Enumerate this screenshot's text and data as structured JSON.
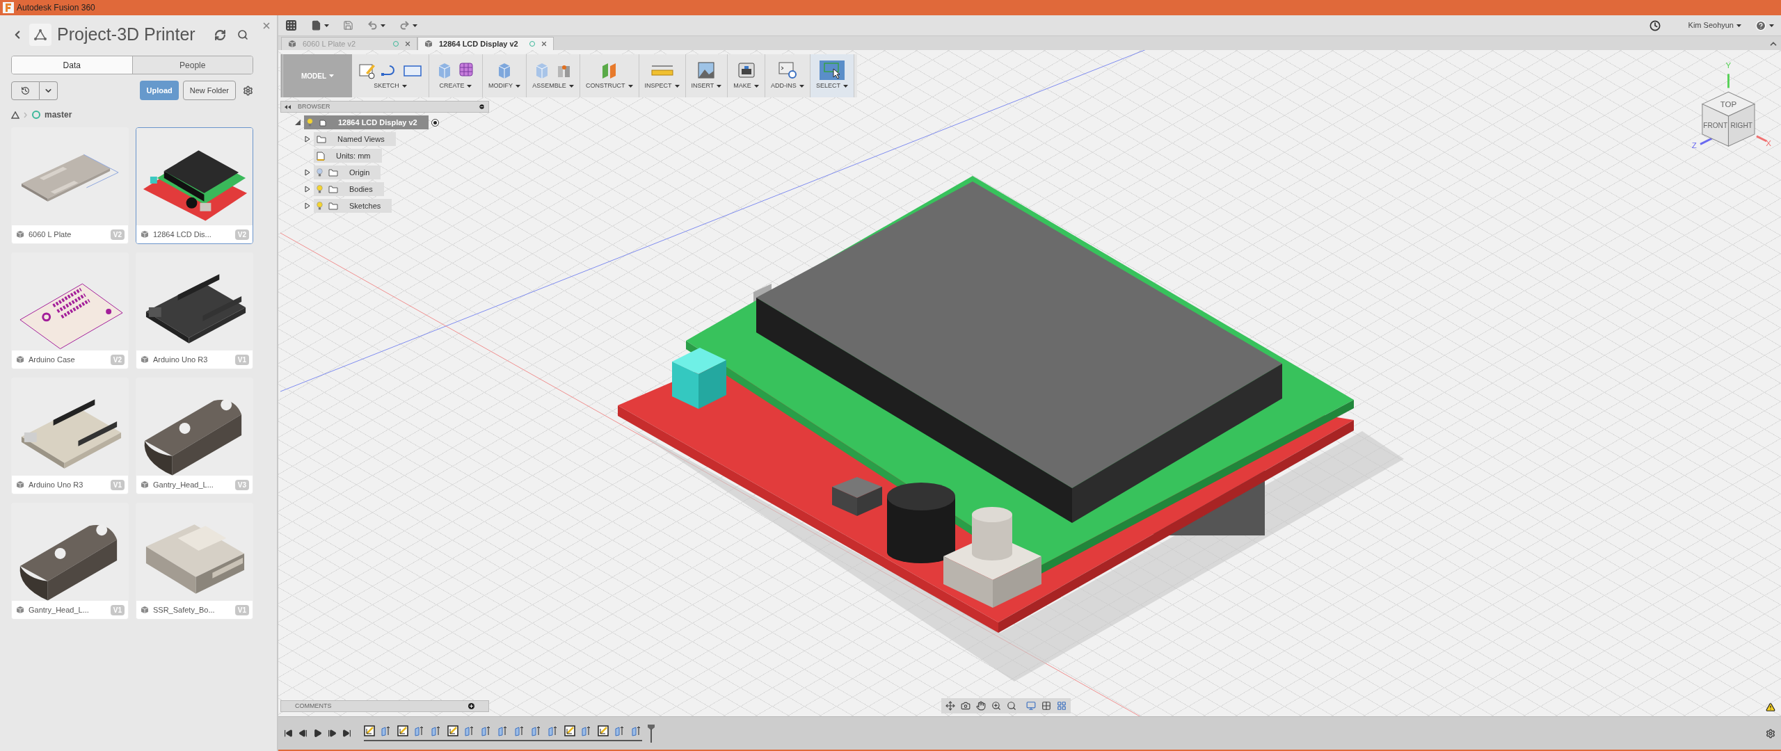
{
  "window": {
    "title": "Autodesk Fusion 360"
  },
  "data_panel": {
    "title": "Project-3D Printer",
    "tabs": [
      {
        "label": "Data",
        "selected": true
      },
      {
        "label": "People",
        "selected": false
      }
    ],
    "buttons": [
      {
        "label": "Upload",
        "kind": "primary"
      },
      {
        "label": "New Folder",
        "kind": "secondary"
      }
    ],
    "breadcrumb": "master",
    "files": [
      {
        "name": "6060 L Plate",
        "version": "V2",
        "selected": false
      },
      {
        "name": "12864 LCD Dis...",
        "version": "V2",
        "selected": true
      },
      {
        "name": "Arduino Case",
        "version": "V2",
        "selected": false
      },
      {
        "name": "Arduino Uno R3",
        "version": "V1",
        "selected": false
      },
      {
        "name": "Arduino Uno R3",
        "version": "V1",
        "selected": false
      },
      {
        "name": "Gantry_Head_L...",
        "version": "V3",
        "selected": false
      },
      {
        "name": "Gantry_Head_L...",
        "version": "V1",
        "selected": false
      },
      {
        "name": "SSR_Safety_Bo...",
        "version": "V1",
        "selected": false
      }
    ]
  },
  "app_bar": {
    "user": "Kim Seohyun"
  },
  "document_tabs": [
    {
      "label": "6060 L Plate v2",
      "selected": false
    },
    {
      "label": "12864 LCD Display v2",
      "selected": true
    }
  ],
  "toolbar": {
    "workspace": "MODEL",
    "groups": [
      {
        "label": "SKETCH",
        "selected": false
      },
      {
        "label": "CREATE",
        "selected": false
      },
      {
        "label": "MODIFY",
        "selected": false
      },
      {
        "label": "ASSEMBLE",
        "selected": false
      },
      {
        "label": "CONSTRUCT",
        "selected": false
      },
      {
        "label": "INSPECT",
        "selected": false
      },
      {
        "label": "INSERT",
        "selected": false
      },
      {
        "label": "MAKE",
        "selected": false
      },
      {
        "label": "ADD-INS",
        "selected": false
      },
      {
        "label": "SELECT",
        "selected": true
      }
    ]
  },
  "browser": {
    "title": "BROWSER",
    "root": {
      "label": "12864 LCD Display v2",
      "expanded": true,
      "visible": true,
      "children": [
        {
          "label": "Named Views",
          "kind": "folder",
          "expanded": false
        },
        {
          "label": "Units: mm",
          "kind": "units"
        },
        {
          "label": "Origin",
          "kind": "folder",
          "expanded": false,
          "visible": false
        },
        {
          "label": "Bodies",
          "kind": "folder",
          "expanded": false,
          "visible": true
        },
        {
          "label": "Sketches",
          "kind": "folder",
          "expanded": false,
          "visible": true
        }
      ]
    }
  },
  "view_cube": {
    "faces": [
      "TOP",
      "FRONT",
      "RIGHT"
    ],
    "axes": [
      "X",
      "Y",
      "Z"
    ]
  },
  "comments": {
    "title": "COMMENTS"
  },
  "timeline": [
    {
      "kind": "sketch"
    },
    {
      "kind": "extrude"
    },
    {
      "kind": "sketch"
    },
    {
      "kind": "extrude"
    },
    {
      "kind": "extrude"
    },
    {
      "kind": "sketch"
    },
    {
      "kind": "extrude"
    },
    {
      "kind": "extrude"
    },
    {
      "kind": "extrude"
    },
    {
      "kind": "extrude"
    },
    {
      "kind": "extrude"
    },
    {
      "kind": "extrude"
    },
    {
      "kind": "sketch"
    },
    {
      "kind": "extrude"
    },
    {
      "kind": "sketch"
    },
    {
      "kind": "extrude"
    },
    {
      "kind": "extrude"
    }
  ]
}
